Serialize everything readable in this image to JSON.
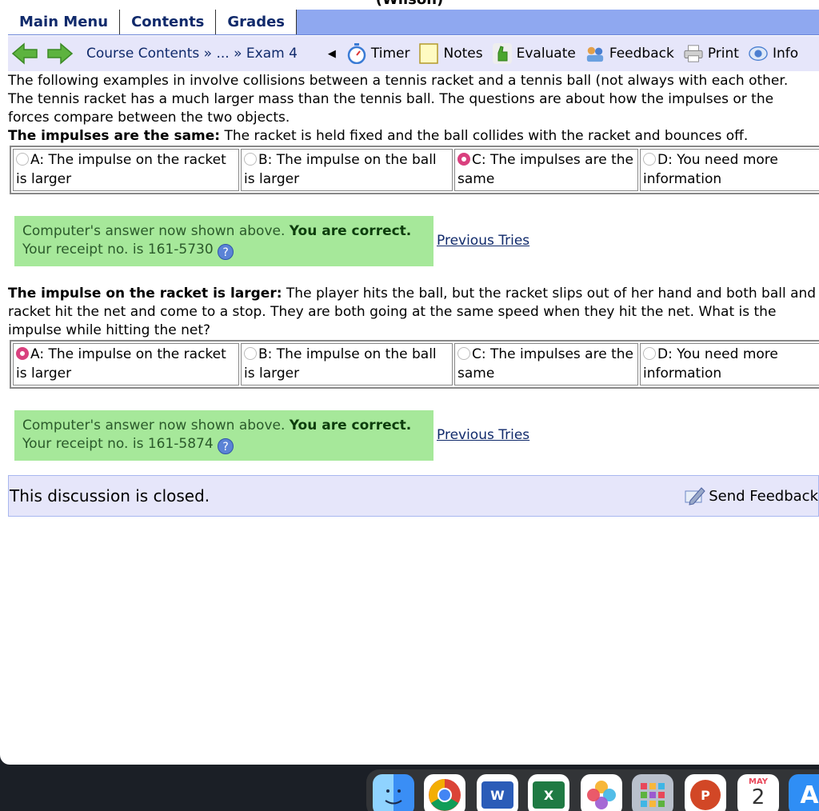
{
  "window": {
    "title": "(Wilson)"
  },
  "menubar": {
    "tabs": [
      {
        "label": "Main Menu"
      },
      {
        "label": "Contents"
      },
      {
        "label": "Grades"
      }
    ]
  },
  "navbar": {
    "breadcrumb_course": "Course Contents",
    "breadcrumb_sep1": " » ",
    "breadcrumb_ellipsis": "...",
    "breadcrumb_sep2": " » ",
    "breadcrumb_current": "Exam 4",
    "tools": {
      "timer": "Timer",
      "notes": "Notes",
      "evaluate": "Evaluate",
      "feedback": "Feedback",
      "print": "Print",
      "info": "Info"
    }
  },
  "problem": {
    "intro_line1": "The following examples in involve collisions between a tennis racket and a tennis ball (not always with each other.",
    "intro_line2": "The tennis racket has a much larger mass than the tennis ball. The questions are about how the impulses or the",
    "intro_line3": "forces compare between the two objects.",
    "questions": [
      {
        "title": "The impulses are the same:",
        "text": " The racket is held fixed and the ball collides with the racket and bounces off.",
        "choices": [
          {
            "label": "A: The impulse on the racket is larger",
            "selected": false
          },
          {
            "label": "B: The impulse on the ball is larger",
            "selected": false
          },
          {
            "label": "C: The impulses are the same",
            "selected": true
          },
          {
            "label": "D: You need more information",
            "selected": false
          }
        ],
        "result_prefix": "Computer's answer now shown above. ",
        "result_status": "You are correct.",
        "receipt": "Your receipt no. is 161-5730",
        "previous_tries": "Previous Tries"
      },
      {
        "title": "The impulse on the racket is larger:",
        "text": " The player hits the ball, but the racket slips out of her hand and both ball and racket hit the net and come to a stop. They are both going at the same speed when they hit the net. What is the impulse while hitting the net?",
        "choices": [
          {
            "label": "A: The impulse on the racket is larger",
            "selected": true
          },
          {
            "label": "B: The impulse on the ball is larger",
            "selected": false
          },
          {
            "label": "C: The impulses are the same",
            "selected": false
          },
          {
            "label": "D: You need more information",
            "selected": false
          }
        ],
        "result_prefix": "Computer's answer now shown above. ",
        "result_status": "You are correct.",
        "receipt": "Your receipt no. is 161-5874",
        "previous_tries": "Previous Tries"
      }
    ]
  },
  "discussion": {
    "status": "This discussion is closed.",
    "send_feedback": "Send Feedback"
  },
  "dock": {
    "calendar_month": "MAY",
    "calendar_day": "2",
    "apps": [
      "finder-icon",
      "chrome-icon",
      "word-icon",
      "excel-icon",
      "photos-icon",
      "launchpad-icon",
      "powerpoint-icon",
      "calendar-icon",
      "app-store-icon"
    ]
  },
  "colors": {
    "menubar": "#8fa8f0",
    "navbar": "#e6e6fa",
    "success": "#a6e89a",
    "selected_radio": "#d9407e",
    "link": "#102a6b"
  }
}
